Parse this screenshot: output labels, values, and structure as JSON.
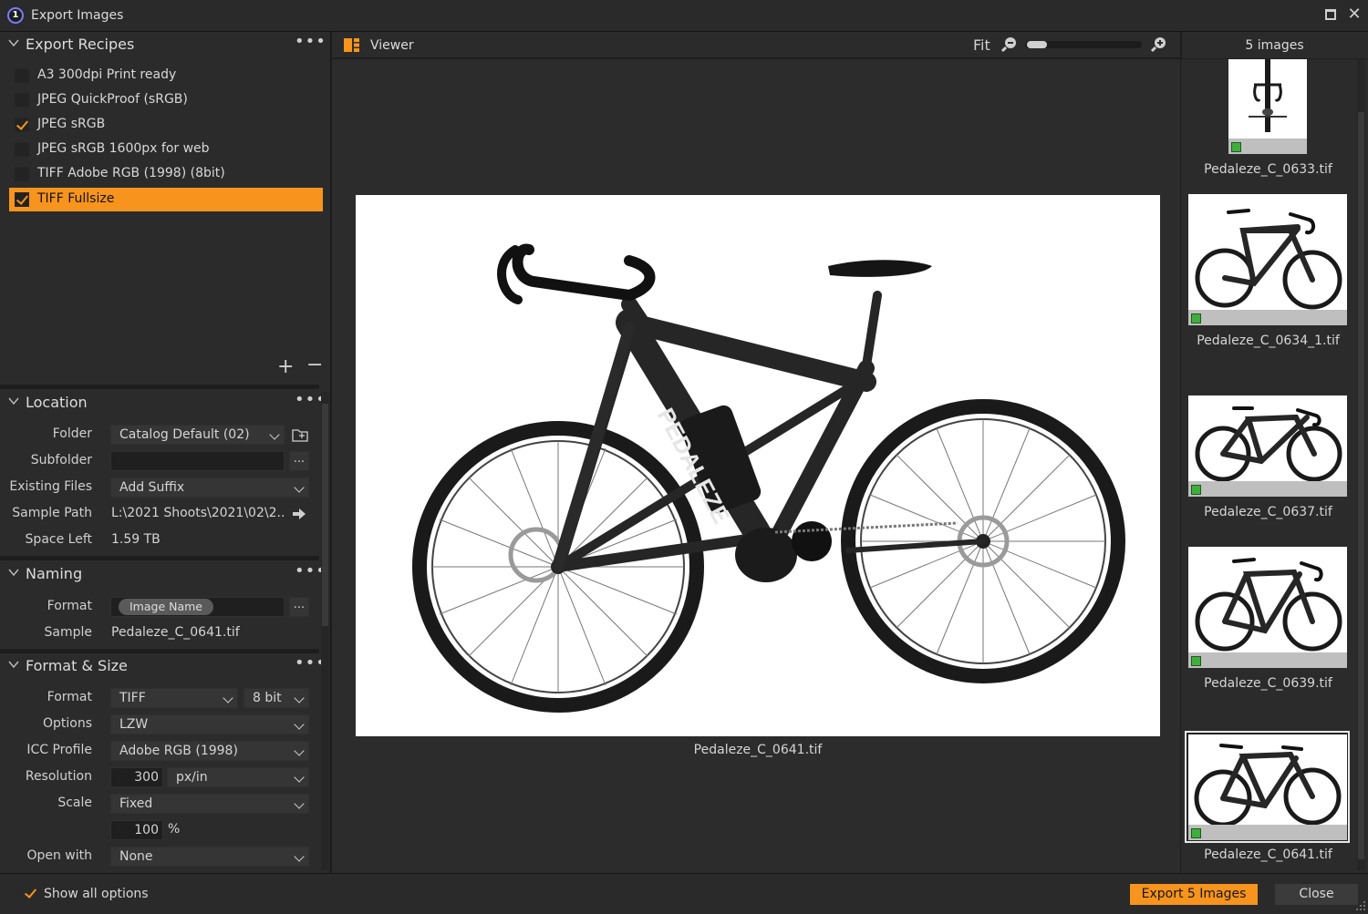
{
  "window": {
    "title": "Export Images"
  },
  "recipes": {
    "title": "Export Recipes",
    "items": [
      {
        "label": "A3 300dpi Print ready",
        "checked": false
      },
      {
        "label": "JPEG QuickProof (sRGB)",
        "checked": false
      },
      {
        "label": "JPEG sRGB",
        "checked": true
      },
      {
        "label": "JPEG sRGB 1600px for web",
        "checked": false
      },
      {
        "label": "TIFF Adobe RGB (1998) (8bit)",
        "checked": false
      },
      {
        "label": "TIFF Fullsize",
        "checked": true,
        "selected": true
      }
    ],
    "add": "+",
    "remove": "−"
  },
  "location": {
    "title": "Location",
    "folder_label": "Folder",
    "folder_value": "Catalog Default (02)",
    "subfolder_label": "Subfolder",
    "subfolder_value": "",
    "existing_label": "Existing Files",
    "existing_value": "Add Suffix",
    "sample_label": "Sample Path",
    "sample_value": "L:\\2021 Shoots\\2021\\02\\2...",
    "space_label": "Space Left",
    "space_value": "1.59 TB"
  },
  "naming": {
    "title": "Naming",
    "format_label": "Format",
    "format_token": "Image Name",
    "sample_label": "Sample",
    "sample_value": "Pedaleze_C_0641.tif"
  },
  "format_size": {
    "title": "Format & Size",
    "format_label": "Format",
    "format_value": "TIFF",
    "bit_value": "8 bit",
    "options_label": "Options",
    "options_value": "LZW",
    "icc_label": "ICC Profile",
    "icc_value": "Adobe RGB (1998)",
    "resolution_label": "Resolution",
    "resolution_value": "300",
    "resolution_unit": "px/in",
    "scale_label": "Scale",
    "scale_value": "Fixed",
    "scale_percent": "100",
    "percent_sign": "%",
    "open_label": "Open with",
    "open_value": "None"
  },
  "viewer": {
    "title": "Viewer",
    "fit_label": "Fit",
    "zoom_level": 0.12,
    "caption": "Pedaleze_C_0641.tif"
  },
  "filmstrip": {
    "count_label": "5 images",
    "items": [
      {
        "name": "Pedaleze_C_0633.tif"
      },
      {
        "name": "Pedaleze_C_0634_1.tif"
      },
      {
        "name": "Pedaleze_C_0637.tif"
      },
      {
        "name": "Pedaleze_C_0639.tif"
      },
      {
        "name": "Pedaleze_C_0641.tif",
        "selected": true
      }
    ]
  },
  "footer": {
    "show_all_label": "Show all options",
    "show_all_checked": true,
    "export_label": "Export 5 Images",
    "close_label": "Close"
  },
  "colors": {
    "accent": "#f7941d",
    "panel": "#2b2b2b",
    "viewer_bg": "#2c2c2c",
    "tag_green": "#3fae3f"
  }
}
